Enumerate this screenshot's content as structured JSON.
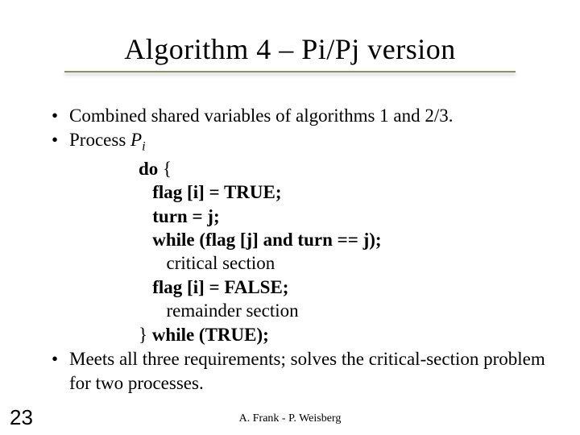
{
  "title": "Algorithm 4 – Pi/Pj version",
  "bullets": {
    "b1": "Combined shared variables of algorithms 1 and 2/3.",
    "b2_prefix": "Process ",
    "b2_proc": "P",
    "b2_sub": "i",
    "b3": "Meets all three requirements; solves the critical-section problem for two processes."
  },
  "code": {
    "l0a": "do",
    "l0b": " {",
    "l1": "   flag [i] = TRUE;",
    "l2": "   turn = j;",
    "l3": "   while (flag [j] and turn == j);",
    "l4": "      critical section",
    "l5": "   flag [i] = FALSE;",
    "l6": "      remainder section",
    "l7a": "} ",
    "l7b": "while (TRUE);"
  },
  "page_number": "23",
  "footer": "A. Frank - P. Weisberg"
}
